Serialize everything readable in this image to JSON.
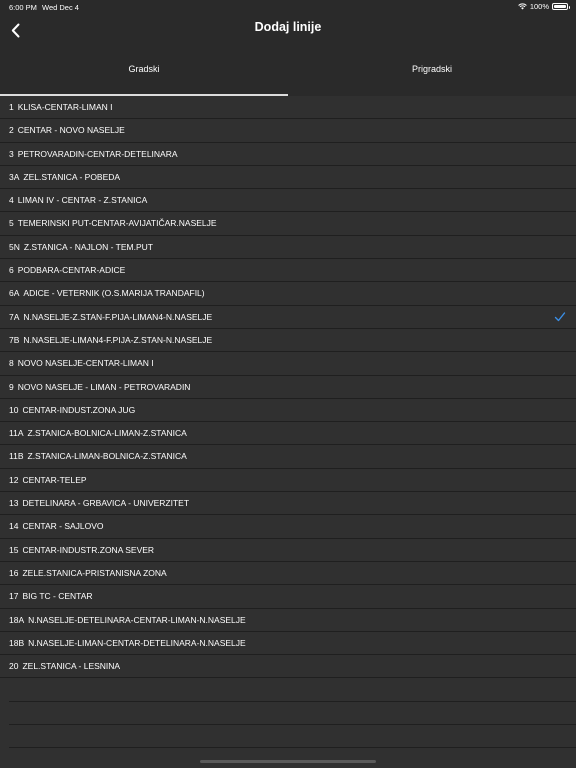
{
  "status": {
    "time": "6:00 PM",
    "date": "Wed Dec 4",
    "battery": "100%"
  },
  "nav": {
    "title": "Dodaj linije"
  },
  "tabs": [
    {
      "label": "Gradski",
      "selected": true
    },
    {
      "label": "Prigradski",
      "selected": false
    }
  ],
  "accent_color": "#3a8ee6",
  "lines": [
    {
      "number": "1",
      "name": "KLISA-CENTAR-LIMAN I",
      "checked": false
    },
    {
      "number": "2",
      "name": "CENTAR - NOVO NASELJE",
      "checked": false
    },
    {
      "number": "3",
      "name": "PETROVARADIN-CENTAR-DETELINARA",
      "checked": false
    },
    {
      "number": "3A",
      "name": "ZEL.STANICA - POBEDA",
      "checked": false
    },
    {
      "number": "4",
      "name": "LIMAN IV - CENTAR - Z.STANICA",
      "checked": false
    },
    {
      "number": "5",
      "name": "TEMERINSKI PUT-CENTAR-AVIJATIČAR.NASELJE",
      "checked": false
    },
    {
      "number": "5N",
      "name": "Z.STANICA - NAJLON - TEM.PUT",
      "checked": false
    },
    {
      "number": "6",
      "name": "PODBARA-CENTAR-ADICE",
      "checked": false
    },
    {
      "number": "6A",
      "name": "ADICE - VETERNIK (O.S.MARIJA TRANDAFIL)",
      "checked": false
    },
    {
      "number": "7A",
      "name": "N.NASELJE-Z.STAN-F.PIJA-LIMAN4-N.NASELJE",
      "checked": true
    },
    {
      "number": "7B",
      "name": "N.NASELJE-LIMAN4-F.PIJA-Z.STAN-N.NASELJE",
      "checked": false
    },
    {
      "number": "8",
      "name": "NOVO NASELJE-CENTAR-LIMAN I",
      "checked": false
    },
    {
      "number": "9",
      "name": "NOVO NASELJE - LIMAN - PETROVARADIN",
      "checked": false
    },
    {
      "number": "10",
      "name": "CENTAR-INDUST.ZONA JUG",
      "checked": false
    },
    {
      "number": "11A",
      "name": "Z.STANICA-BOLNICA-LIMAN-Z.STANICA",
      "checked": false
    },
    {
      "number": "11B",
      "name": "Z.STANICA-LIMAN-BOLNICA-Z.STANICA",
      "checked": false
    },
    {
      "number": "12",
      "name": "CENTAR-TELEP",
      "checked": false
    },
    {
      "number": "13",
      "name": "DETELINARA - GRBAVICA - UNIVERZITET",
      "checked": false
    },
    {
      "number": "14",
      "name": "CENTAR - SAJLOVO",
      "checked": false
    },
    {
      "number": "15",
      "name": "CENTAR-INDUSTR.ZONA SEVER",
      "checked": false
    },
    {
      "number": "16",
      "name": "ZELE.STANICA-PRISTANISNA ZONA",
      "checked": false
    },
    {
      "number": "17",
      "name": "BIG TC - CENTAR",
      "checked": false
    },
    {
      "number": "18A",
      "name": "N.NASELJE-DETELINARA-CENTAR-LIMAN-N.NASELJE",
      "checked": false
    },
    {
      "number": "18B",
      "name": "N.NASELJE-LIMAN-CENTAR-DETELINARA-N.NASELJE",
      "checked": false
    },
    {
      "number": "20",
      "name": "ZEL.STANICA - LESNINA",
      "checked": false
    }
  ]
}
